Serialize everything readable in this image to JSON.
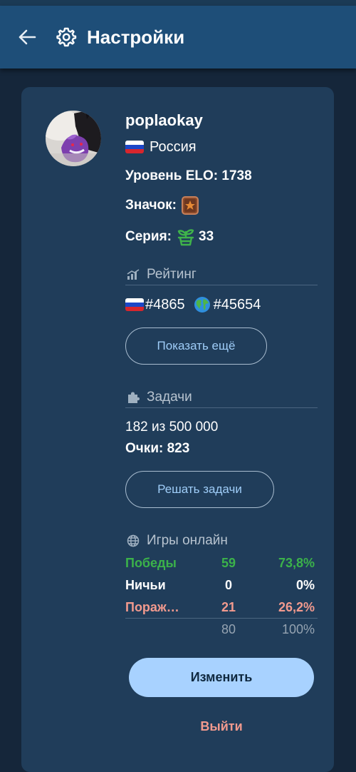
{
  "header": {
    "title": "Настройки"
  },
  "profile": {
    "username": "poplaokay",
    "country": "Россия",
    "elo": "Уровень ELO: 1738",
    "badge_label": "Значок:",
    "streak_label": "Серия:",
    "streak_value": "33"
  },
  "rating": {
    "title": "Рейтинг",
    "country_rank": "#4865",
    "world_rank": "#45654",
    "show_more_label": "Показать ещё"
  },
  "tasks": {
    "title": "Задачи",
    "progress": "182 из 500 000",
    "points": "Очки: 823",
    "solve_label": "Решать задачи"
  },
  "games": {
    "title": "Игры онлайн",
    "rows": [
      {
        "label": "Победы",
        "count": "59",
        "percent": "73,8%"
      },
      {
        "label": "Ничьи",
        "count": "0",
        "percent": "0%"
      },
      {
        "label": "Пораж…",
        "count": "21",
        "percent": "26,2%"
      }
    ],
    "total": {
      "count": "80",
      "percent": "100%"
    }
  },
  "actions": {
    "edit_label": "Изменить",
    "logout_label": "Выйти"
  },
  "colors": {
    "background": "#15263a",
    "appbar": "#1e4e78",
    "card": "#203d5a",
    "accent_button": "#a8d2ff",
    "win": "#3bb24a",
    "loss": "#f29a8e"
  }
}
